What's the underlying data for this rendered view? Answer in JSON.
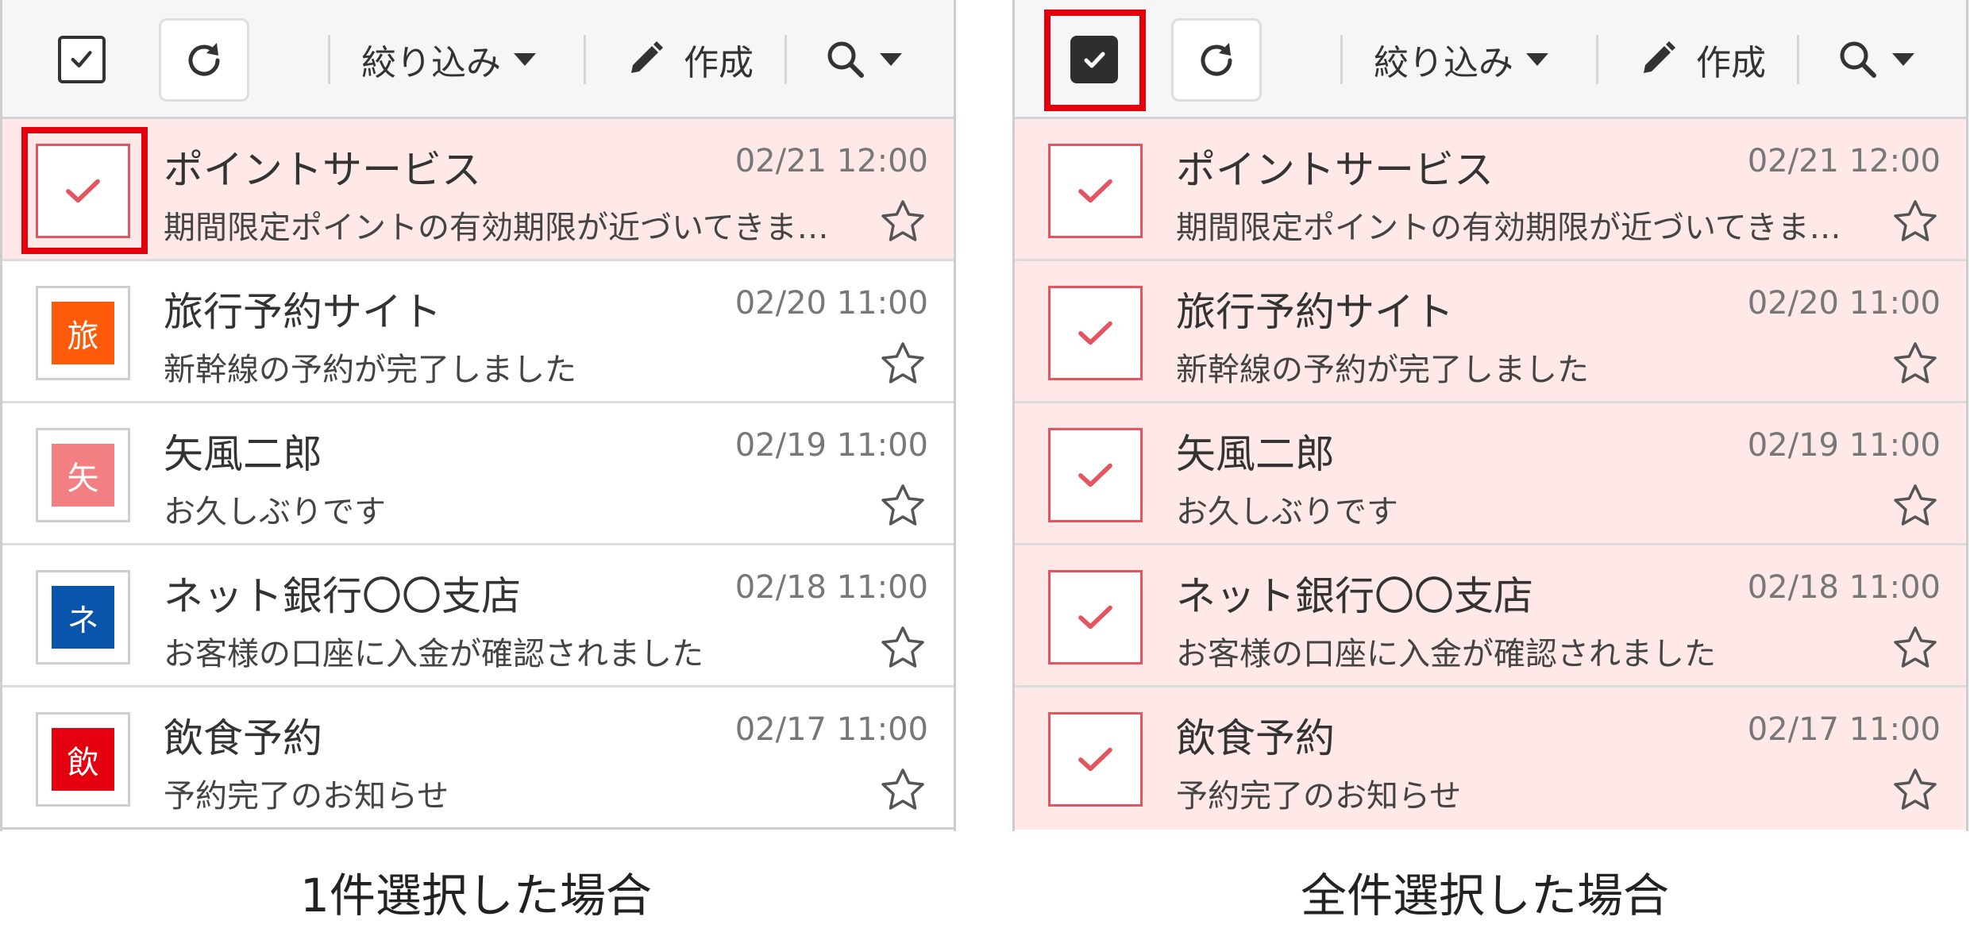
{
  "toolbar": {
    "filter_label": "絞り込み",
    "compose_label": "作成"
  },
  "messages": [
    {
      "sender": "ポイントサービス",
      "date": "02/21 12:00",
      "subject": "期間限定ポイントの有効期限が近づいてきま…",
      "initial": "",
      "color": ""
    },
    {
      "sender": "旅行予約サイト",
      "date": "02/20 11:00",
      "subject": "新幹線の予約が完了しました",
      "initial": "旅",
      "color": "#fd5a09"
    },
    {
      "sender": "矢風二郎",
      "date": "02/19 11:00",
      "subject": "お久しぶりです",
      "initial": "矢",
      "color": "#f27f81"
    },
    {
      "sender": "ネット銀行〇〇支店",
      "date": "02/18 11:00",
      "subject": "お客様の口座に入金が確認されました",
      "initial": "ネ",
      "color": "#0a55ac"
    },
    {
      "sender": "飲食予約",
      "date": "02/17 11:00",
      "subject": "予約完了のお知らせ",
      "initial": "飲",
      "color": "#e5000f"
    }
  ],
  "captions": {
    "single": "1件選択した場合",
    "all": "全件選択した場合"
  },
  "colors": {
    "selected_row_bg": "#fee8e8",
    "check_red": "#e4555f",
    "highlight_red": "#e1000b"
  }
}
